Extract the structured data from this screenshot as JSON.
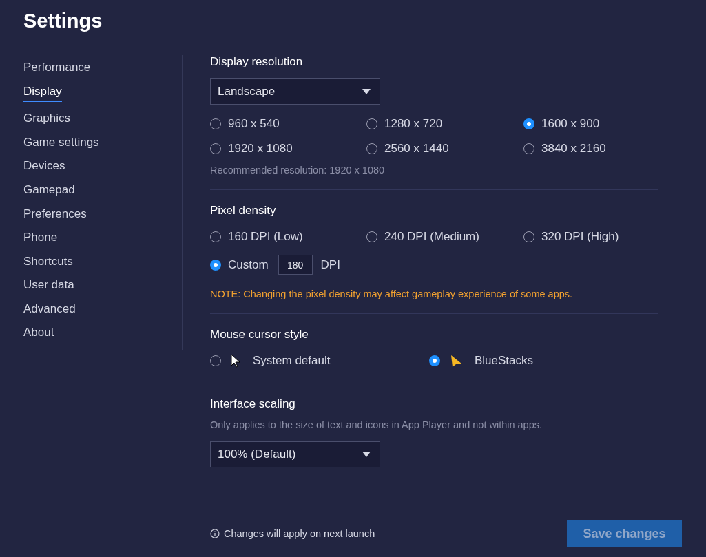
{
  "title": "Settings",
  "sidebar": {
    "items": [
      {
        "label": "Performance",
        "selected": false
      },
      {
        "label": "Display",
        "selected": true
      },
      {
        "label": "Graphics",
        "selected": false
      },
      {
        "label": "Game settings",
        "selected": false
      },
      {
        "label": "Devices",
        "selected": false
      },
      {
        "label": "Gamepad",
        "selected": false
      },
      {
        "label": "Preferences",
        "selected": false
      },
      {
        "label": "Phone",
        "selected": false
      },
      {
        "label": "Shortcuts",
        "selected": false
      },
      {
        "label": "User data",
        "selected": false
      },
      {
        "label": "Advanced",
        "selected": false
      },
      {
        "label": "About",
        "selected": false
      }
    ]
  },
  "display_resolution": {
    "heading": "Display resolution",
    "orientation": "Landscape",
    "options": [
      {
        "label": "960 x 540",
        "selected": false
      },
      {
        "label": "1280 x 720",
        "selected": false
      },
      {
        "label": "1600 x 900",
        "selected": true
      },
      {
        "label": "1920 x 1080",
        "selected": false
      },
      {
        "label": "2560 x 1440",
        "selected": false
      },
      {
        "label": "3840 x 2160",
        "selected": false
      }
    ],
    "recommended": "Recommended resolution: 1920 x 1080"
  },
  "pixel_density": {
    "heading": "Pixel density",
    "options": [
      {
        "label": "160 DPI (Low)",
        "selected": false
      },
      {
        "label": "240 DPI (Medium)",
        "selected": false
      },
      {
        "label": "320 DPI (High)",
        "selected": false
      }
    ],
    "custom": {
      "label": "Custom",
      "selected": true,
      "value": "180",
      "unit": "DPI"
    },
    "note": "NOTE: Changing the pixel density may affect gameplay experience of some apps."
  },
  "mouse_cursor_style": {
    "heading": "Mouse cursor style",
    "options": [
      {
        "label": "System default",
        "kind": "system",
        "selected": false
      },
      {
        "label": "BlueStacks",
        "kind": "bluestacks",
        "selected": true
      }
    ]
  },
  "interface_scaling": {
    "heading": "Interface scaling",
    "description": "Only applies to the size of text and icons in App Player and not within apps.",
    "value": "100% (Default)"
  },
  "footer": {
    "info": "Changes will apply on next launch",
    "save_button": {
      "label": "Save changes",
      "disabled": true
    }
  }
}
